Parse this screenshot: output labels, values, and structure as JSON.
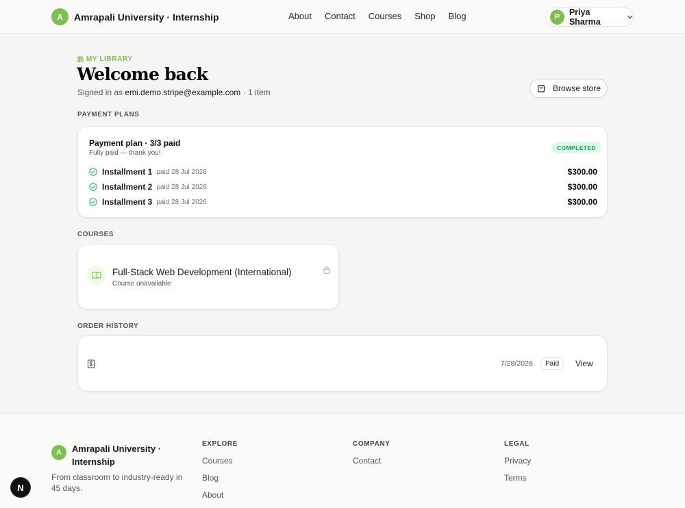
{
  "header": {
    "logo_letter": "A",
    "brand": "Amrapali University · Internship",
    "nav": [
      "About",
      "Contact",
      "Courses",
      "Shop",
      "Blog"
    ],
    "user": {
      "initial": "P",
      "name": "Priya Sharma"
    }
  },
  "main": {
    "eyebrow": "MY LIBRARY",
    "title": "Welcome back",
    "signed_in_prefix": "Signed in as ",
    "email": "emi.demo.stripe@example.com",
    "signed_in_suffix": " · 1 item",
    "browse_label": "Browse store"
  },
  "payment_plans": {
    "section_label": "PAYMENT PLANS",
    "title": "Payment plan · 3/3 paid",
    "subtitle": "Fully paid — thank you!",
    "status": "COMPLETED",
    "installments": [
      {
        "name": "Installment 1",
        "date": "paid 28 Jul 2026",
        "amount": "$300.00"
      },
      {
        "name": "Installment 2",
        "date": "paid 28 Jul 2026",
        "amount": "$300.00"
      },
      {
        "name": "Installment 3",
        "date": "paid 28 Jul 2026",
        "amount": "$300.00"
      }
    ]
  },
  "courses": {
    "section_label": "COURSES",
    "items": [
      {
        "title": "Full-Stack Web Development (International)",
        "status": "Course unavailable"
      }
    ]
  },
  "orders": {
    "section_label": "ORDER HISTORY",
    "items": [
      {
        "date": "7/28/2026",
        "status": "Paid",
        "action": "View"
      }
    ]
  },
  "footer": {
    "logo_letter": "A",
    "brand": "Amrapali University · Internship",
    "tagline": "From classroom to industry-ready in 45 days.",
    "columns": [
      {
        "title": "EXPLORE",
        "links": [
          "Courses",
          "Blog",
          "About"
        ]
      },
      {
        "title": "COMPANY",
        "links": [
          "Contact"
        ]
      },
      {
        "title": "LEGAL",
        "links": [
          "Privacy",
          "Terms"
        ]
      }
    ]
  },
  "dev_badge": "N",
  "colors": {
    "brand_green": "#7cc04f",
    "success_green": "#16a34a",
    "background": "#f5f5f4"
  }
}
